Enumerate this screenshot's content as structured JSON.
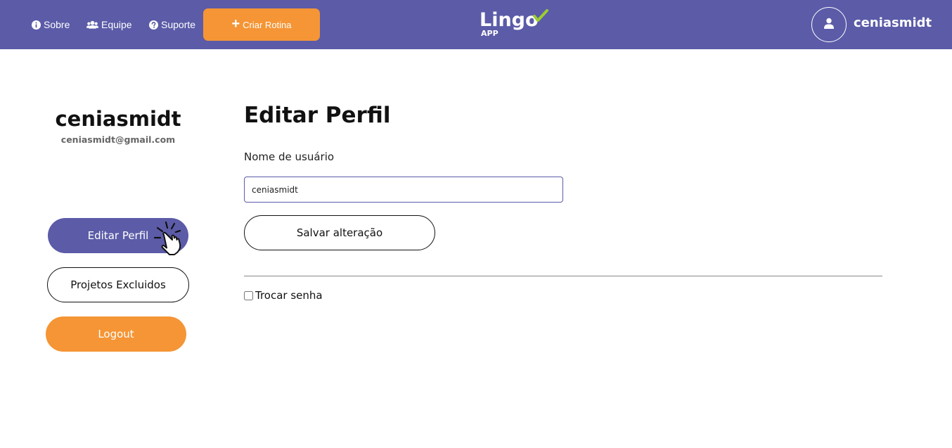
{
  "header": {
    "nav": [
      {
        "label": "Sobre",
        "icon": "info-icon"
      },
      {
        "label": "Equipe",
        "icon": "users-icon"
      },
      {
        "label": "Suporte",
        "icon": "question-icon"
      }
    ],
    "create_button": {
      "label": "Criar Rotina",
      "icon": "plus-icon"
    },
    "logo_text": "Lingo APP",
    "username": "ceniasmidt",
    "avatar_icon": "user-icon"
  },
  "sidebar": {
    "name": "ceniasmidt",
    "email": "ceniasmidt@gmail.com",
    "buttons": {
      "edit": "Editar Perfil",
      "deleted": "Projetos Excluidos",
      "logout": "Logout"
    },
    "cursor_icon": "pointer-hand-icon"
  },
  "main": {
    "title": "Editar Perfil",
    "username_label": "Nome de usuário",
    "username_value": "ceniasmidt",
    "save_label": "Salvar alteração",
    "change_password_label": "Trocar senha",
    "change_password_checked": false
  },
  "colors": {
    "primary": "#5b5ba8",
    "accent": "#f59535",
    "logo_check": "#9acd32"
  }
}
